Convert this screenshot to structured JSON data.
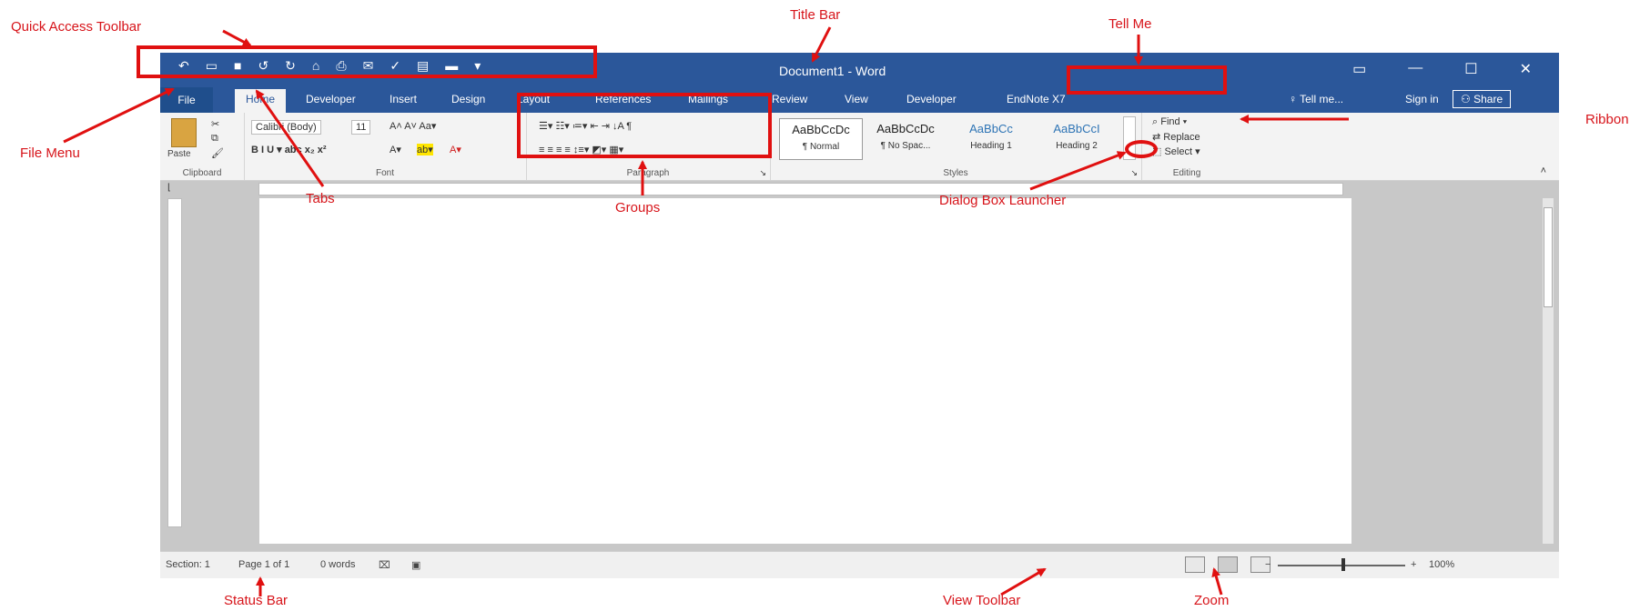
{
  "annotations": {
    "quick_access_toolbar": "Quick Access Toolbar",
    "title_bar": "Title Bar",
    "tell_me": "Tell Me",
    "file_menu": "File Menu",
    "tabs": "Tabs",
    "groups": "Groups",
    "dialog_box_launcher": "Dialog Box Launcher",
    "ribbon": "Ribbon",
    "status_bar": "Status Bar",
    "view_toolbar": "View Toolbar",
    "zoom": "Zoom"
  },
  "window": {
    "title": "Document1 - Word",
    "qat_icons": [
      "undo-arrow-icon",
      "new-document-icon",
      "save-icon",
      "undo-icon",
      "redo-icon",
      "open-icon",
      "print-icon",
      "email-icon",
      "spelling-icon",
      "draw-table-icon",
      "quick-print-icon",
      "customize-dropdown-icon"
    ]
  },
  "tabs": [
    "File",
    "Home",
    "Developer",
    "Insert",
    "Design",
    "Layout",
    "References",
    "Mailings",
    "Review",
    "View",
    "Developer",
    "EndNote X7"
  ],
  "tell_me_label": "Tell me...",
  "sign_in": "Sign in",
  "share": "Share",
  "ribbon": {
    "clipboard_label": "Clipboard",
    "paste_label": "Paste",
    "font_name": "Calibri (Body)",
    "font_size": "11",
    "font_label": "Font",
    "paragraph_label": "Paragraph",
    "styles_label": "Styles",
    "editing_label": "Editing",
    "styles": [
      {
        "preview": "AaBbCcDc",
        "name": "¶ Normal"
      },
      {
        "preview": "AaBbCcDc",
        "name": "¶ No Spac..."
      },
      {
        "preview": "AaBbCc",
        "name": "Heading 1"
      },
      {
        "preview": "AaBbCcI",
        "name": "Heading 2"
      }
    ],
    "find": "Find",
    "replace": "Replace",
    "select": "Select"
  },
  "status": {
    "section": "Section: 1",
    "page": "Page 1 of 1",
    "words": "0 words",
    "zoom_percent": "100%"
  },
  "colors": {
    "title_bar": "#2b579a",
    "annotation_red": "#e01010"
  }
}
